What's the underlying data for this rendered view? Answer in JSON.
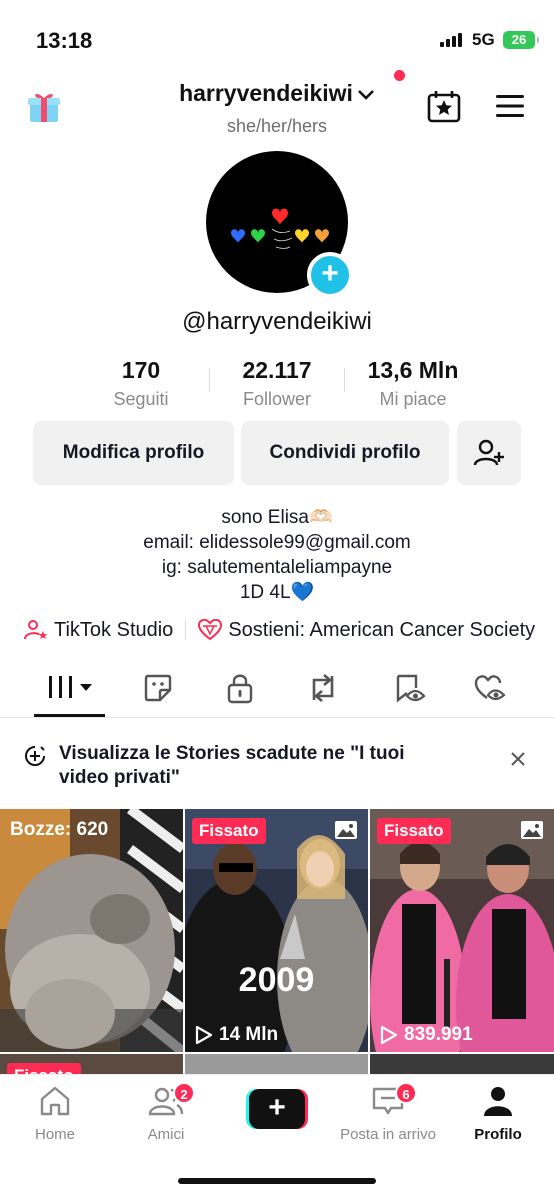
{
  "status_bar": {
    "time": "13:18",
    "network": "5G",
    "battery": "26"
  },
  "header": {
    "username": "harryvendeikiwi",
    "pronouns": "she/her/hers"
  },
  "profile": {
    "handle": "@harryvendeikiwi",
    "stats": [
      {
        "value": "170",
        "label": "Seguiti"
      },
      {
        "value": "22.117",
        "label": "Follower"
      },
      {
        "value": "13,6 Mln",
        "label": "Mi piace"
      }
    ],
    "buttons": {
      "edit": "Modifica profilo",
      "share": "Condividi profilo"
    },
    "bio": [
      "sono Elisa🫶🏻",
      "email: elidessole99@gmail.com",
      "ig: salutementaleliampayne",
      "1D 4L💙"
    ],
    "links": {
      "studio": "TikTok Studio",
      "support": "Sostieni: American Cancer Society"
    }
  },
  "notice": {
    "text": "Visualizza le Stories scadute ne \"I tuoi video privati\""
  },
  "grid": [
    {
      "caption": "Bozze: 620"
    },
    {
      "pinned": "Fissato",
      "overlay": "2009",
      "views": "14 Mln"
    },
    {
      "pinned": "Fissato",
      "views": "839.991"
    }
  ],
  "grid_row2": {
    "pinned": "Fissato"
  },
  "bottom_nav": [
    {
      "label": "Home"
    },
    {
      "label": "Amici",
      "badge": "2"
    },
    {
      "label": ""
    },
    {
      "label": "Posta in arrivo",
      "badge": "6"
    },
    {
      "label": "Profilo"
    }
  ],
  "colors": {
    "accent": "#fe2c55",
    "cyan": "#20c1e6",
    "battery": "#34c759"
  }
}
